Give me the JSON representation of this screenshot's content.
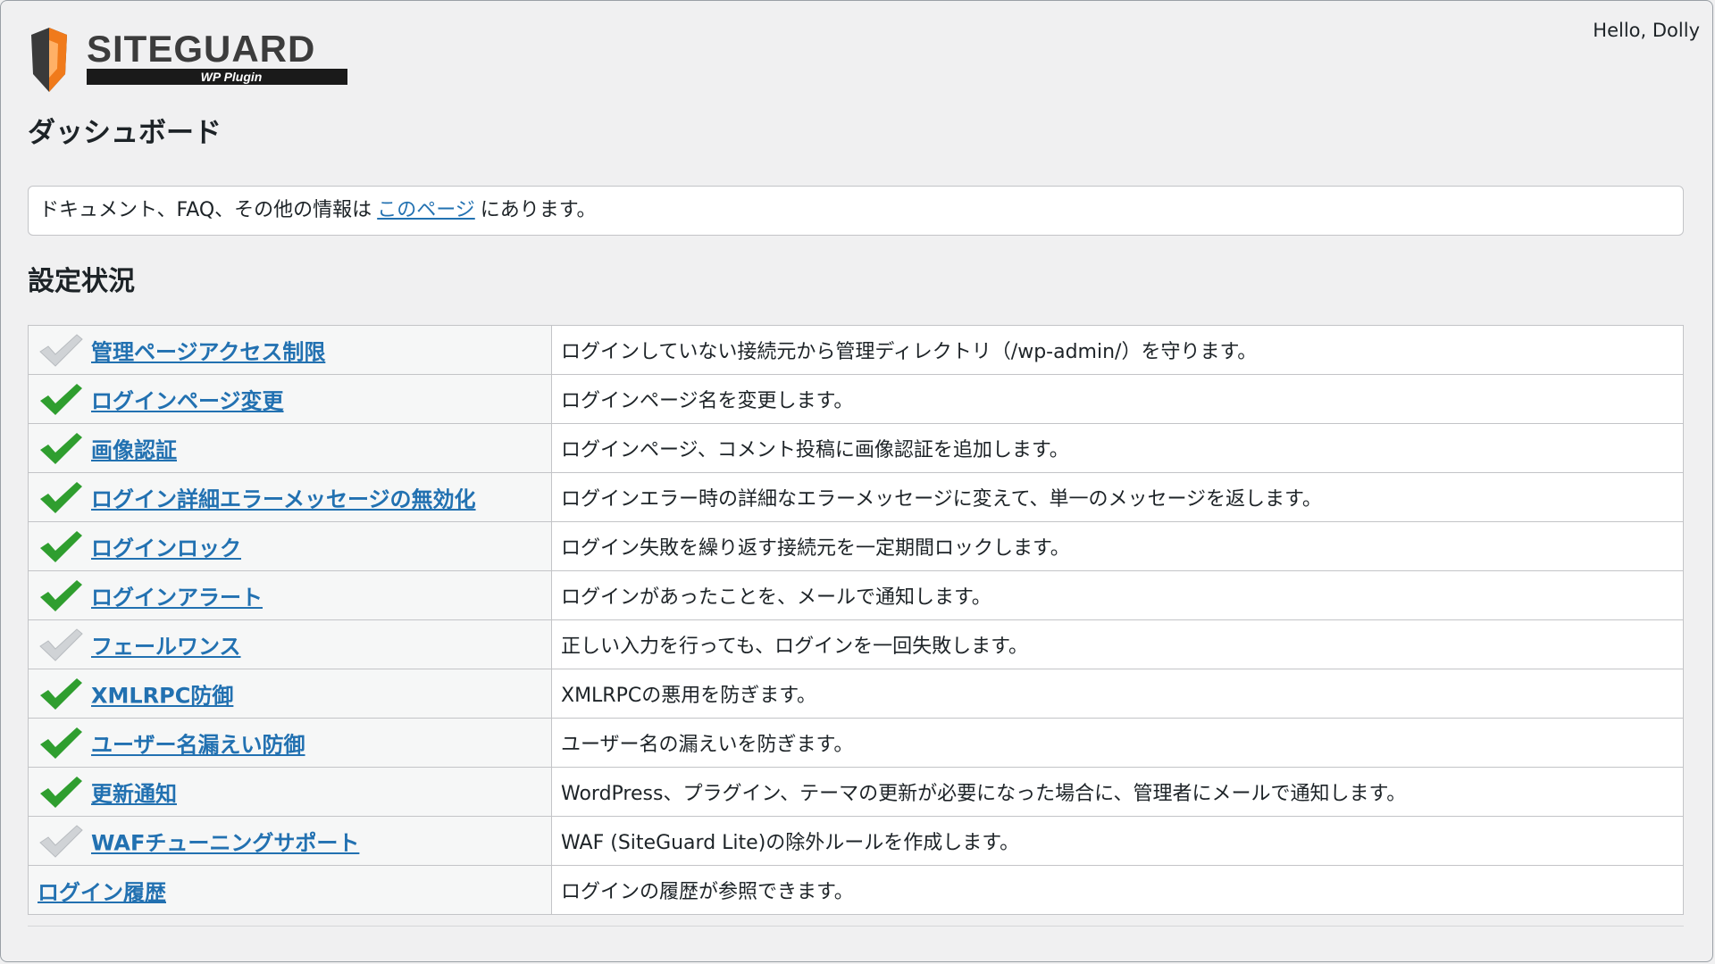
{
  "header": {
    "greeting": "Hello, Dolly",
    "logo": {
      "brand": "SITEGUARD",
      "sub": "WP Plugin",
      "brand_color": "#3c3c3c",
      "accent": "#f07a1b"
    }
  },
  "page": {
    "title": "ダッシュボード",
    "notice": {
      "before": "ドキュメント、FAQ、その他の情報は",
      "link": "このページ",
      "after": "にあります。"
    },
    "section_title": "設定状況"
  },
  "colors": {
    "link": "#2271b1",
    "check_on": "#2f9e2f",
    "check_off": "#d0d3d6"
  },
  "features": [
    {
      "status": "off",
      "name": "管理ページアクセス制限",
      "desc": "ログインしていない接続元から管理ディレクトリ（/wp-admin/）を守ります。"
    },
    {
      "status": "on",
      "name": "ログインページ変更",
      "desc": "ログインページ名を変更します。"
    },
    {
      "status": "on",
      "name": "画像認証",
      "desc": "ログインページ、コメント投稿に画像認証を追加します。"
    },
    {
      "status": "on",
      "name": "ログイン詳細エラーメッセージの無効化",
      "desc": "ログインエラー時の詳細なエラーメッセージに変えて、単一のメッセージを返します。"
    },
    {
      "status": "on",
      "name": "ログインロック",
      "desc": "ログイン失敗を繰り返す接続元を一定期間ロックします。"
    },
    {
      "status": "on",
      "name": "ログインアラート",
      "desc": "ログインがあったことを、メールで通知します。"
    },
    {
      "status": "off",
      "name": "フェールワンス",
      "desc": "正しい入力を行っても、ログインを一回失敗します。"
    },
    {
      "status": "on",
      "name": "XMLRPC防御",
      "desc": "XMLRPCの悪用を防ぎます。"
    },
    {
      "status": "on",
      "name": "ユーザー名漏えい防御",
      "desc": "ユーザー名の漏えいを防ぎます。"
    },
    {
      "status": "on",
      "name": "更新通知",
      "desc": "WordPress、プラグイン、テーマの更新が必要になった場合に、管理者にメールで通知します。"
    },
    {
      "status": "off",
      "name": "WAFチューニングサポート",
      "desc": "WAF (SiteGuard Lite)の除外ルールを作成します。"
    },
    {
      "status": "none",
      "name": "ログイン履歴",
      "desc": "ログインの履歴が参照できます。"
    }
  ]
}
